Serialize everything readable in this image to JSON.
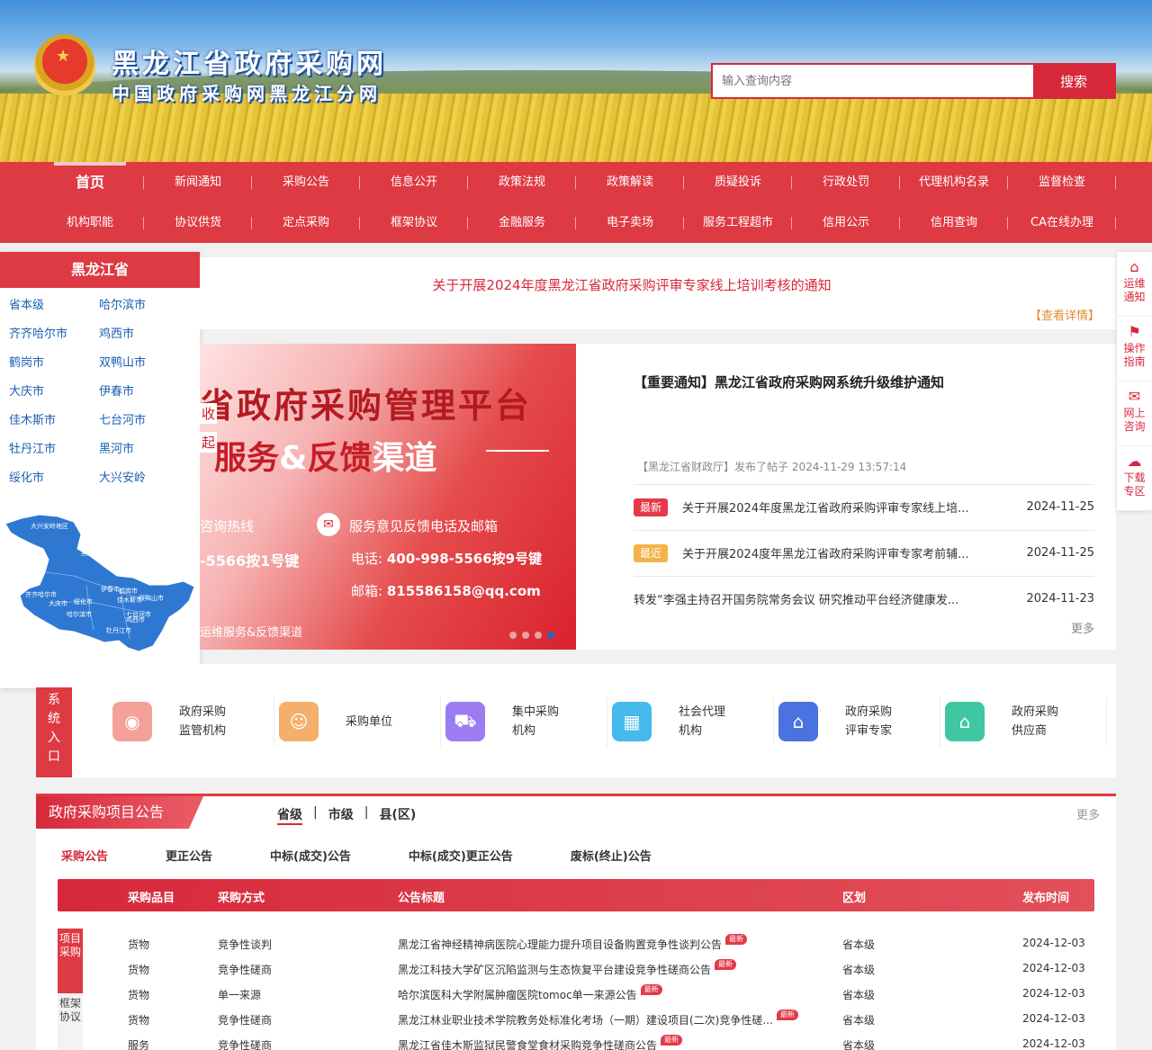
{
  "header": {
    "site_title": "黑龙江省政府采购网",
    "site_subtitle": "中国政府采购网黑龙江分网",
    "search_placeholder": "输入查询内容",
    "search_button": "搜索"
  },
  "nav": {
    "row1": [
      "首页",
      "新闻通知",
      "采购公告",
      "信息公开",
      "政策法规",
      "政策解读",
      "质疑投诉",
      "行政处罚",
      "代理机构名录",
      "监督检查"
    ],
    "row2": [
      "机构职能",
      "协议供货",
      "定点采购",
      "框架协议",
      "金融服务",
      "电子卖场",
      "服务工程超市",
      "信用公示",
      "信用查询",
      "CA在线办理"
    ],
    "active": "首页"
  },
  "region": {
    "title": "黑龙江省",
    "items": [
      "省本级",
      "哈尔滨市",
      "齐齐哈尔市",
      "鸡西市",
      "鹤岗市",
      "双鸭山市",
      "大庆市",
      "伊春市",
      "佳木斯市",
      "七台河市",
      "牡丹江市",
      "黑河市",
      "绥化市",
      "大兴安岭"
    ],
    "map_labels": [
      "大兴安岭地区",
      "黑",
      "齐齐哈尔市",
      "伊春市",
      "鹤岗市",
      "佳木斯市",
      "双鸭山市",
      "大庆市",
      "绥化市",
      "哈尔滨市",
      "七台河市",
      "鸡西市",
      "牡丹江市"
    ]
  },
  "notice": {
    "title": "关于开展2024年度黑龙江省政府采购评审专家线上培训考核的通知",
    "more": "【查看详情】"
  },
  "carousel": {
    "title_line1": "省政府采购管理平台",
    "title_line2_a": "服务",
    "title_line2_amp": "&",
    "title_line2_b": "反馈",
    "title_line2_c": "渠道",
    "frag_a": "收",
    "frag_b": "起",
    "hotline_label": "咨询热线",
    "hotline_value": "-5566按1号键",
    "feedback_label": "服务意见反馈电话及邮箱",
    "tel_prefix": "电话: ",
    "tel_value": "400-998-5566按9号键",
    "mail_prefix": "邮箱: ",
    "mail_value": "815586158@qq.com",
    "caption": "运维服务&反馈渠道",
    "dots": 4,
    "active_dot": 4
  },
  "news": {
    "headline": "【重要通知】黑龙江省政府采购网系统升级维护通知",
    "meta": "【黑龙江省财政厅】发布了帖子 2024-11-29 13:57:14",
    "items": [
      {
        "tag": "最新",
        "tag_type": "new",
        "title": "关于开展2024年度黑龙江省政府采购评审专家线上培...",
        "date": "2024-11-25"
      },
      {
        "tag": "最近",
        "tag_type": "recent",
        "title": "关于开展2024度年黑龙江省政府采购评审专家考前辅...",
        "date": "2024-11-25"
      },
      {
        "tag": "",
        "tag_type": "none",
        "title": "转发“李强主持召开国务院常务会议 研究推动平台经济健康发...",
        "date": "2024-11-23"
      }
    ],
    "more": "更多"
  },
  "float": {
    "items": [
      {
        "label": "运维通知",
        "icon": "bag-icon"
      },
      {
        "label": "操作指南",
        "icon": "bookmark-icon"
      },
      {
        "label": "网上咨询",
        "icon": "chat-icon"
      },
      {
        "label": "下载专区",
        "icon": "cloud-download-icon"
      }
    ]
  },
  "entry": {
    "tab_label": "系统入口",
    "items": [
      {
        "line1": "政府采购",
        "line2": "监管机构",
        "icon": "camera-icon",
        "color": "#f4a19a"
      },
      {
        "line1": "采购单位",
        "line2": "",
        "icon": "user-icon",
        "color": "#f4b06a"
      },
      {
        "line1": "集中采购",
        "line2": "机构",
        "icon": "cart-icon",
        "color": "#9c7cf0"
      },
      {
        "line1": "社会代理",
        "line2": "机构",
        "icon": "building-icon",
        "color": "#45b8ec"
      },
      {
        "line1": "政府采购",
        "line2": "评审专家",
        "icon": "graduate-icon",
        "color": "#4a72e0"
      },
      {
        "line1": "政府采购",
        "line2": "供应商",
        "icon": "home-icon",
        "color": "#3fc7a2"
      }
    ]
  },
  "procurement": {
    "title": "政府采购项目公告",
    "levels": [
      "省级",
      "市级",
      "县(区)"
    ],
    "active_level": "省级",
    "more": "更多",
    "tabs": [
      "采购公告",
      "更正公告",
      "中标(成交)公告",
      "中标(成交)更正公告",
      "废标(终止)公告"
    ],
    "active_tab": "采购公告",
    "columns": [
      "采购品目",
      "采购方式",
      "公告标题",
      "区划",
      "发布时间"
    ],
    "side_tabs": [
      "项目采购",
      "框架协议"
    ],
    "rows": [
      {
        "category": "货物",
        "method": "竞争性谈判",
        "title": "黑龙江省神经精神病医院心理能力提升项目设备购置竞争性谈判公告",
        "badge": "最新",
        "region": "省本级",
        "date": "2024-12-03"
      },
      {
        "category": "货物",
        "method": "竞争性磋商",
        "title": "黑龙江科技大学矿区沉陷监测与生态恢复平台建设竞争性磋商公告",
        "badge": "最新",
        "region": "省本级",
        "date": "2024-12-03"
      },
      {
        "category": "货物",
        "method": "单一来源",
        "title": "哈尔滨医科大学附属肿瘤医院tomoc单一来源公告",
        "badge": "最新",
        "region": "省本级",
        "date": "2024-12-03"
      },
      {
        "category": "货物",
        "method": "竞争性磋商",
        "title": "黑龙江林业职业技术学院教务处标准化考场（一期）建设项目(二次)竞争性磋...",
        "badge": "最新",
        "region": "省本级",
        "date": "2024-12-03"
      },
      {
        "category": "服务",
        "method": "竞争性磋商",
        "title": "黑龙江省佳木斯监狱民警食堂食材采购竞争性磋商公告",
        "badge": "最新",
        "region": "省本级",
        "date": "2024-12-03"
      }
    ]
  },
  "colors": {
    "brand_red": "#de3a44",
    "link_blue": "#1b5fb0",
    "accent_orange": "#e68a2e"
  }
}
